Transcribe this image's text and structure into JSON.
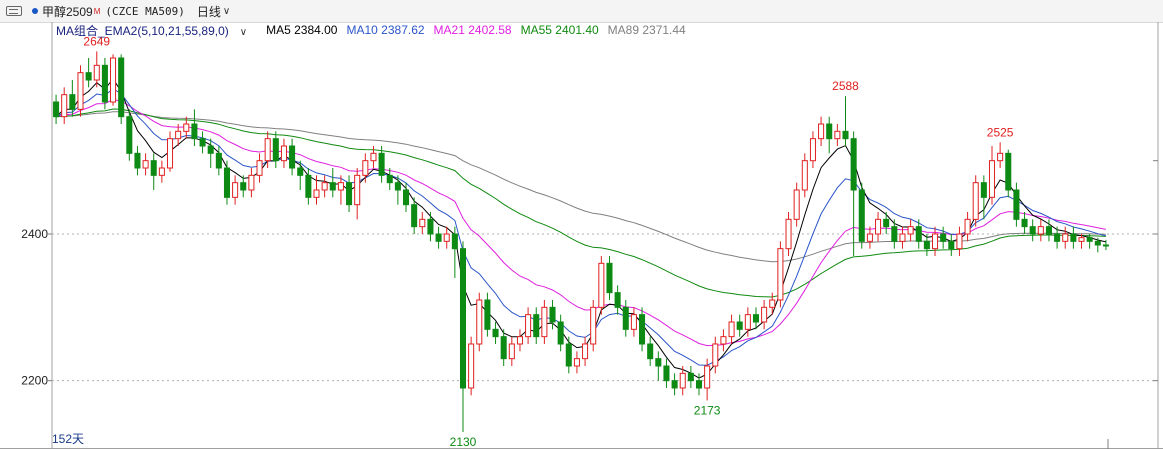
{
  "topbar": {
    "symbol": "甲醇2509",
    "symbol_badge": "M",
    "contract": "(CZCE MA509)",
    "period": "日线",
    "accent": "#1a57c6"
  },
  "legend": {
    "combo": "MA组合_EMA2(5,10,21,55,89,0)",
    "items": [
      {
        "text": "MA5 2384.00",
        "color": "#000000"
      },
      {
        "text": "MA10 2387.62",
        "color": "#2a55c8"
      },
      {
        "text": "MA21 2402.58",
        "color": "#e020e0"
      },
      {
        "text": "MA55 2401.40",
        "color": "#108a10"
      },
      {
        "text": "MA89 2371.44",
        "color": "#808080"
      }
    ]
  },
  "footer": {
    "days": "152天"
  },
  "chart_data": {
    "type": "candlestick",
    "ylim": [
      2130,
      2649
    ],
    "yticks": [
      2200,
      2400
    ],
    "colors": {
      "up": "#e02020",
      "down": "#0c8a14",
      "ma5": "#000000",
      "ma10": "#2a55c8",
      "ma21": "#e020e0",
      "ma55": "#108a10",
      "ma89": "#808080"
    },
    "annotations": [
      {
        "label": "2649",
        "index": 5,
        "value": 2649,
        "color": "#e02020",
        "pos": "above"
      },
      {
        "label": "2588",
        "index": 97,
        "value": 2588,
        "color": "#e02020",
        "pos": "above"
      },
      {
        "label": "2525",
        "index": 116,
        "value": 2525,
        "color": "#e02020",
        "pos": "above"
      },
      {
        "label": "2130",
        "index": 50,
        "value": 2130,
        "color": "#0c8a14",
        "pos": "below"
      },
      {
        "label": "2173",
        "index": 80,
        "value": 2173,
        "color": "#0c8a14",
        "pos": "below"
      }
    ],
    "candles": [
      [
        2580,
        2560,
        2590,
        2550
      ],
      [
        2560,
        2590,
        2600,
        2550
      ],
      [
        2590,
        2570,
        2610,
        2560
      ],
      [
        2570,
        2620,
        2630,
        2560
      ],
      [
        2620,
        2610,
        2640,
        2600
      ],
      [
        2610,
        2630,
        2649,
        2600
      ],
      [
        2630,
        2580,
        2640,
        2570
      ],
      [
        2580,
        2640,
        2645,
        2575
      ],
      [
        2640,
        2560,
        2645,
        2550
      ],
      [
        2560,
        2510,
        2570,
        2500
      ],
      [
        2510,
        2490,
        2520,
        2480
      ],
      [
        2490,
        2500,
        2510,
        2480
      ],
      [
        2500,
        2480,
        2510,
        2460
      ],
      [
        2480,
        2490,
        2500,
        2470
      ],
      [
        2490,
        2530,
        2540,
        2485
      ],
      [
        2530,
        2540,
        2550,
        2520
      ],
      [
        2540,
        2550,
        2560,
        2530
      ],
      [
        2550,
        2530,
        2570,
        2520
      ],
      [
        2530,
        2520,
        2540,
        2510
      ],
      [
        2520,
        2510,
        2530,
        2490
      ],
      [
        2510,
        2490,
        2520,
        2480
      ],
      [
        2490,
        2450,
        2500,
        2440
      ],
      [
        2450,
        2470,
        2480,
        2440
      ],
      [
        2470,
        2460,
        2480,
        2450
      ],
      [
        2460,
        2480,
        2490,
        2450
      ],
      [
        2480,
        2500,
        2510,
        2470
      ],
      [
        2500,
        2530,
        2540,
        2490
      ],
      [
        2530,
        2500,
        2540,
        2490
      ],
      [
        2500,
        2520,
        2530,
        2490
      ],
      [
        2520,
        2490,
        2530,
        2480
      ],
      [
        2490,
        2480,
        2500,
        2460
      ],
      [
        2480,
        2450,
        2490,
        2440
      ],
      [
        2450,
        2460,
        2480,
        2440
      ],
      [
        2460,
        2470,
        2480,
        2450
      ],
      [
        2470,
        2460,
        2490,
        2450
      ],
      [
        2460,
        2470,
        2480,
        2440
      ],
      [
        2470,
        2440,
        2480,
        2430
      ],
      [
        2440,
        2480,
        2490,
        2420
      ],
      [
        2480,
        2500,
        2510,
        2470
      ],
      [
        2500,
        2510,
        2520,
        2490
      ],
      [
        2510,
        2480,
        2520,
        2470
      ],
      [
        2480,
        2470,
        2490,
        2460
      ],
      [
        2470,
        2460,
        2480,
        2440
      ],
      [
        2460,
        2440,
        2470,
        2430
      ],
      [
        2440,
        2410,
        2450,
        2400
      ],
      [
        2410,
        2420,
        2430,
        2400
      ],
      [
        2420,
        2400,
        2430,
        2390
      ],
      [
        2400,
        2390,
        2410,
        2380
      ],
      [
        2390,
        2400,
        2410,
        2380
      ],
      [
        2400,
        2380,
        2410,
        2340
      ],
      [
        2380,
        2190,
        2390,
        2130
      ],
      [
        2190,
        2250,
        2260,
        2180
      ],
      [
        2250,
        2310,
        2320,
        2240
      ],
      [
        2310,
        2270,
        2320,
        2260
      ],
      [
        2270,
        2260,
        2280,
        2250
      ],
      [
        2260,
        2230,
        2270,
        2220
      ],
      [
        2230,
        2250,
        2260,
        2220
      ],
      [
        2250,
        2260,
        2270,
        2240
      ],
      [
        2260,
        2290,
        2300,
        2250
      ],
      [
        2290,
        2260,
        2300,
        2250
      ],
      [
        2260,
        2300,
        2310,
        2250
      ],
      [
        2300,
        2280,
        2310,
        2270
      ],
      [
        2280,
        2250,
        2290,
        2240
      ],
      [
        2250,
        2220,
        2260,
        2210
      ],
      [
        2220,
        2230,
        2240,
        2210
      ],
      [
        2230,
        2250,
        2260,
        2220
      ],
      [
        2250,
        2300,
        2310,
        2240
      ],
      [
        2300,
        2360,
        2370,
        2290
      ],
      [
        2360,
        2320,
        2370,
        2310
      ],
      [
        2320,
        2300,
        2330,
        2290
      ],
      [
        2300,
        2270,
        2310,
        2260
      ],
      [
        2270,
        2290,
        2300,
        2260
      ],
      [
        2290,
        2250,
        2300,
        2240
      ],
      [
        2250,
        2230,
        2260,
        2220
      ],
      [
        2230,
        2220,
        2240,
        2200
      ],
      [
        2220,
        2200,
        2230,
        2190
      ],
      [
        2200,
        2190,
        2210,
        2180
      ],
      [
        2190,
        2210,
        2220,
        2180
      ],
      [
        2210,
        2200,
        2220,
        2190
      ],
      [
        2200,
        2190,
        2210,
        2180
      ],
      [
        2190,
        2220,
        2230,
        2173
      ],
      [
        2220,
        2250,
        2260,
        2210
      ],
      [
        2250,
        2260,
        2270,
        2240
      ],
      [
        2260,
        2280,
        2290,
        2250
      ],
      [
        2280,
        2270,
        2290,
        2260
      ],
      [
        2270,
        2290,
        2300,
        2260
      ],
      [
        2290,
        2280,
        2300,
        2270
      ],
      [
        2280,
        2300,
        2310,
        2270
      ],
      [
        2300,
        2310,
        2320,
        2290
      ],
      [
        2310,
        2380,
        2390,
        2300
      ],
      [
        2380,
        2420,
        2430,
        2370
      ],
      [
        2420,
        2460,
        2470,
        2410
      ],
      [
        2460,
        2500,
        2510,
        2450
      ],
      [
        2500,
        2530,
        2540,
        2490
      ],
      [
        2530,
        2550,
        2560,
        2520
      ],
      [
        2550,
        2530,
        2560,
        2510
      ],
      [
        2530,
        2540,
        2550,
        2520
      ],
      [
        2540,
        2530,
        2588,
        2520
      ],
      [
        2530,
        2460,
        2540,
        2370
      ],
      [
        2460,
        2390,
        2470,
        2380
      ],
      [
        2390,
        2400,
        2410,
        2380
      ],
      [
        2400,
        2420,
        2430,
        2390
      ],
      [
        2420,
        2410,
        2430,
        2400
      ],
      [
        2410,
        2390,
        2420,
        2380
      ],
      [
        2390,
        2400,
        2410,
        2380
      ],
      [
        2400,
        2410,
        2420,
        2390
      ],
      [
        2410,
        2390,
        2420,
        2380
      ],
      [
        2390,
        2380,
        2400,
        2370
      ],
      [
        2380,
        2400,
        2410,
        2370
      ],
      [
        2400,
        2390,
        2410,
        2380
      ],
      [
        2390,
        2380,
        2400,
        2370
      ],
      [
        2380,
        2400,
        2410,
        2370
      ],
      [
        2400,
        2420,
        2430,
        2390
      ],
      [
        2420,
        2470,
        2480,
        2410
      ],
      [
        2470,
        2450,
        2480,
        2420
      ],
      [
        2450,
        2500,
        2520,
        2440
      ],
      [
        2500,
        2510,
        2525,
        2490
      ],
      [
        2510,
        2460,
        2515,
        2450
      ],
      [
        2460,
        2420,
        2470,
        2410
      ],
      [
        2420,
        2410,
        2430,
        2400
      ],
      [
        2410,
        2400,
        2420,
        2390
      ],
      [
        2400,
        2410,
        2420,
        2390
      ],
      [
        2410,
        2400,
        2420,
        2390
      ],
      [
        2400,
        2390,
        2410,
        2380
      ],
      [
        2390,
        2400,
        2410,
        2380
      ],
      [
        2400,
        2390,
        2410,
        2380
      ],
      [
        2390,
        2395,
        2400,
        2380
      ],
      [
        2395,
        2390,
        2400,
        2380
      ],
      [
        2390,
        2385,
        2395,
        2375
      ],
      [
        2385,
        2384,
        2392,
        2378
      ]
    ]
  }
}
